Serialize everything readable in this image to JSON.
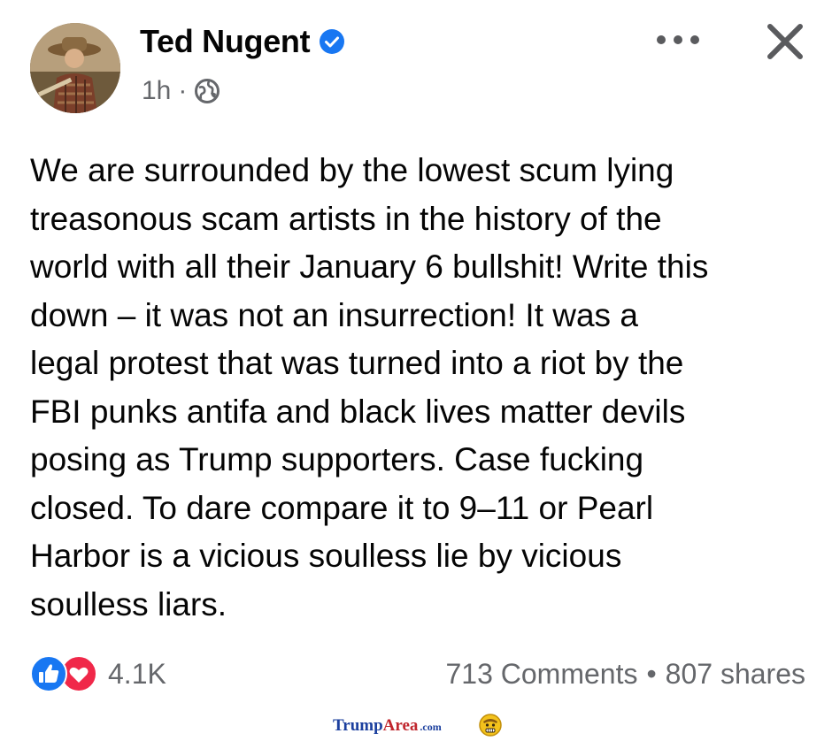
{
  "post": {
    "author_name": "Ted Nugent",
    "verified": true,
    "timestamp": "1h",
    "separator": "·",
    "audience_icon": "globe-icon",
    "body": "We are surrounded by the lowest scum lying\ntreasonous scam artists in the history of the\nworld with all their January 6 bullshit! Write this\ndown – it was not an insurrection! It was a\nlegal protest that was turned into a riot by the\nFBI punks antifa and black lives matter devils\nposing as Trump supporters. Case fucking\nclosed. To dare compare it to 9–11 or Pearl\nHarbor is a vicious soulless lie by vicious\nsoulless liars."
  },
  "header_actions": {
    "more_icon": "more-horizontal-icon",
    "close_icon": "close-icon"
  },
  "engagement": {
    "reaction_icons": [
      "like-icon",
      "love-icon"
    ],
    "reaction_count": "4.1K",
    "comments": "713 Comments",
    "dot": "•",
    "shares": "807 shares"
  },
  "watermark": {
    "part1": "Trump",
    "part2": "Area",
    "part3": ".com"
  },
  "colors": {
    "verified_blue": "#1877f2",
    "like_blue": "#1877f2",
    "love_red": "#f02849",
    "muted_text": "#65676b",
    "text": "#050505"
  }
}
